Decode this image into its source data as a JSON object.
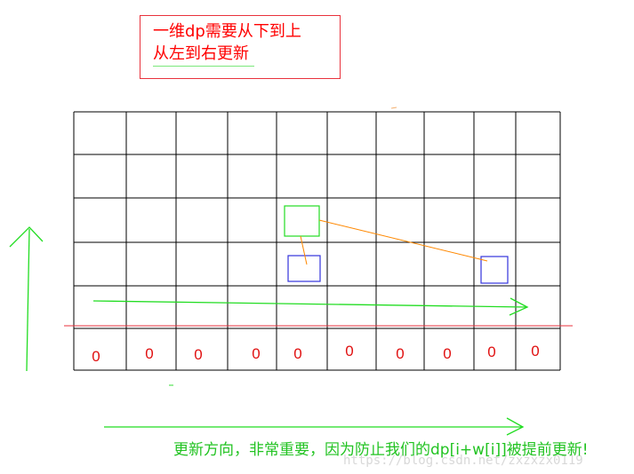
{
  "note": {
    "line1": "一维dp需要从下到上",
    "line2": "从左到右更新"
  },
  "base_row": {
    "values": [
      "0",
      "0",
      "0",
      "0",
      "0",
      "0",
      "0",
      "0",
      "0",
      "0"
    ]
  },
  "caption": "更新方向，非常重要，因为防止我们的dp[i+w[i]]被提前更新!",
  "watermark": "https://blog.csdn.net/zxzxzx0119",
  "colors": {
    "grid": "#000000",
    "red": "#e8323c",
    "green": "#22dd22",
    "blue": "#3333dd",
    "orange": "#ff8800"
  }
}
